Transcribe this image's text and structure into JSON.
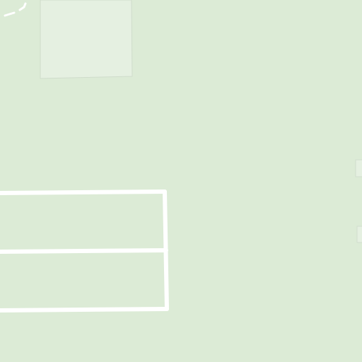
{
  "map": {
    "colors": {
      "background": "#dcebd6",
      "parcel_fill": "#e5f0e1",
      "parcel_stroke": "#cfdccb",
      "path": "#ffffff",
      "path_dash": "#ffffff",
      "feature_fill": "#e5f0e1",
      "feature_stroke": "#d1ddcd"
    }
  }
}
